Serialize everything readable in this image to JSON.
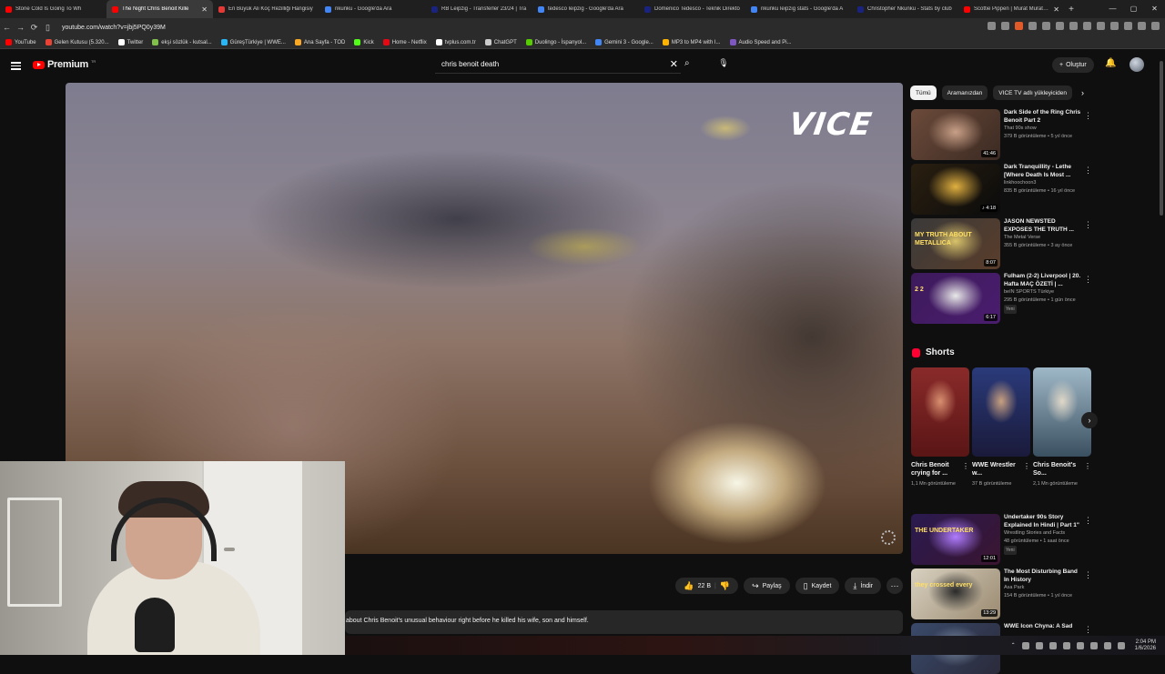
{
  "tabs": [
    {
      "title": "Stone Cold Is Going To Wh",
      "color": "#ff0000",
      "active": false
    },
    {
      "title": "The Night Chris Benoit Kille",
      "color": "#ff0000",
      "active": true
    },
    {
      "title": "En Büyük Ali Koç Rezilliği Hangisiy",
      "color": "#e53935",
      "active": false
    },
    {
      "title": "nkunku - Google'da Ara",
      "color": "#4285f4",
      "active": false
    },
    {
      "title": "RB Leipzig - Transferler 23/24 | Tra",
      "color": "#1a237e",
      "active": false
    },
    {
      "title": "tedesco leipzig - Google'da Ara",
      "color": "#4285f4",
      "active": false
    },
    {
      "title": "Domenico Tedesco - Teknik Direktö",
      "color": "#1a237e",
      "active": false
    },
    {
      "title": "nkunku leipzig stats - Google'da A",
      "color": "#4285f4",
      "active": false
    },
    {
      "title": "Christopher Nkunku - Stats by club",
      "color": "#1a237e",
      "active": false
    },
    {
      "title": "Scottie Pippen | Murat Murathan Y",
      "color": "#ff0000",
      "active": false
    }
  ],
  "window_controls": [
    "—",
    "▢",
    "✕"
  ],
  "address": {
    "url": "youtube.com/watch?v=jbj5PQ0y39M"
  },
  "bookmarks": [
    {
      "label": "YouTube",
      "color": "#ff0000"
    },
    {
      "label": "Gelen Kutusu (5.320...",
      "color": "#ea4335"
    },
    {
      "label": "Twitter",
      "color": "#ffffff"
    },
    {
      "label": "ekşi sözlük - kutsal...",
      "color": "#81c14b"
    },
    {
      "label": "GüreşTürkiye | WWE...",
      "color": "#29b6f6"
    },
    {
      "label": "Ana Sayfa - TOD",
      "color": "#f9a825"
    },
    {
      "label": "Kick",
      "color": "#53fc18"
    },
    {
      "label": "Home - Netflix",
      "color": "#e50914"
    },
    {
      "label": "tvplus.com.tr",
      "color": "#ffffff"
    },
    {
      "label": "ChatGPT",
      "color": "#cccccc"
    },
    {
      "label": "Duolingo - İspanyol...",
      "color": "#58cc02"
    },
    {
      "label": "Gemini 3 - Google...",
      "color": "#4285f4"
    },
    {
      "label": "MP3 to MP4 with I...",
      "color": "#ffb300"
    },
    {
      "label": "Audio Speed and Pi...",
      "color": "#7e57c2"
    }
  ],
  "yt": {
    "logo_text": "Premium",
    "logo_region": "TR",
    "search_value": "chris benoit death",
    "create_label": "Oluştur",
    "brand_color": "#ff0000"
  },
  "video": {
    "watermark": "VICE",
    "like_count": "22 B",
    "share_label": "Paylaş",
    "save_label": "Kaydet",
    "download_label": "İndir",
    "description": "about Chris Benoit's unusual behaviour right before he killed his wife, son and himself."
  },
  "chips": [
    "Tümü",
    "Aramanızdan",
    "VICE TV adlı yükleyiciden"
  ],
  "recommendations": [
    {
      "title": "Dark Side of the Ring Chris Benoit Part 2",
      "channel": "That 90s show",
      "views": "379 B görüntüleme • 5 yıl önce",
      "duration": "41:46",
      "colors": [
        "#6b4a3a",
        "#c9a088",
        "#3b2a22"
      ],
      "badge": ""
    },
    {
      "title": "Dark Tranquillity - Lethe [Where Death Is Most ...",
      "channel": "linkhoochoon3",
      "views": "835 B görüntüleme • 16 yıl önce",
      "duration": "♪ 4:18",
      "colors": [
        "#2a1f10",
        "#e0b040",
        "#0b0b0b"
      ],
      "badge": ""
    },
    {
      "title": "JASON NEWSTED EXPOSES THE TRUTH ...",
      "channel": "The Metal Verse",
      "views": "355 B görüntüleme • 3 ay önce",
      "duration": "8:07",
      "colors": [
        "#3a3a3a",
        "#d9c36a",
        "#5a3d2a"
      ],
      "badge": "",
      "thumb_text": "MY TRUTH ABOUT METALLICA"
    },
    {
      "title": "Fulham (2-2) Liverpool | 20. Hafta MAÇ ÖZETİ | ...",
      "channel": "beIN SPORTS Türkiye",
      "views": "295 B görüntüleme • 1 gün önce",
      "duration": "6:17",
      "colors": [
        "#3d1a5c",
        "#e8e8e8",
        "#4a1d6e"
      ],
      "badge": "Yeni",
      "thumb_text": "2 2"
    },
    {
      "title": "Undertaker 90s Story Explained In Hindi | Part 1\"",
      "channel": "Wrestling Stories and Facts",
      "views": "48 görüntüleme • 1 saat önce",
      "duration": "12:01",
      "colors": [
        "#2a1a50",
        "#b07cff",
        "#3a1530"
      ],
      "badge": "Yeni",
      "thumb_text": "THE UNDERTAKER"
    },
    {
      "title": "The Most Disturbing Band In History",
      "channel": "Asa Park",
      "views": "154 B görüntüleme • 1 yıl önce",
      "duration": "13:29",
      "colors": [
        "#d8d0c0",
        "#2a2a2a",
        "#9a8a70"
      ],
      "badge": "",
      "thumb_text": "they crossed every"
    },
    {
      "title": "WWE Icon Chyna: A Sad",
      "channel": "",
      "views": "",
      "duration": "",
      "colors": [
        "#3a4a6a",
        "#7a8aa0",
        "#2a2a3a"
      ],
      "badge": ""
    }
  ],
  "shorts_title": "Shorts",
  "shorts": [
    {
      "title": "Chris Benoit crying for ...",
      "views": "1,1 Mn görüntüleme",
      "colors": [
        "#8a2a2a",
        "#d89070",
        "#5a1515"
      ]
    },
    {
      "title": "WWE Wrestler w...",
      "views": "37 B görüntüleme",
      "colors": [
        "#2a3a7a",
        "#c9a080",
        "#1a1a3a"
      ]
    },
    {
      "title": "Chris Benoit's So...",
      "views": "2,1 Mn görüntüleme",
      "colors": [
        "#9fb8c8",
        "#e0d8c8",
        "#3a5060"
      ]
    }
  ],
  "taskbar": {
    "time": "2:04 PM",
    "date": "1/6/2026"
  }
}
